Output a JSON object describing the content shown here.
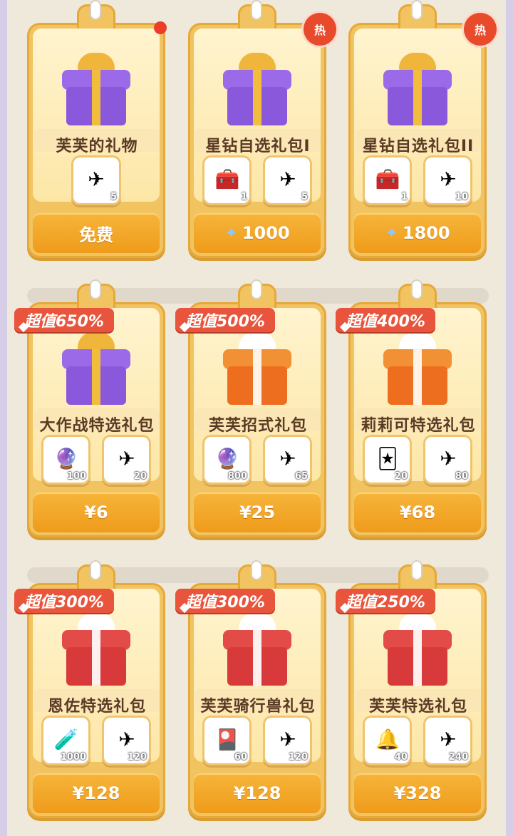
{
  "colors": {
    "accent": "#ef9b1b",
    "hot": "#e84a2c",
    "banner": "#e9543c"
  },
  "cards": [
    {
      "title": "芙芙的礼物",
      "price": "免费",
      "price_icon": "",
      "badge": "",
      "show_dot": true,
      "gift": "purple",
      "items": [
        {
          "icon": "paper-plane-icon",
          "glyph": "✈",
          "count": "5"
        }
      ]
    },
    {
      "title": "星钻自选礼包I",
      "price": "1000",
      "price_icon": "star-icon",
      "badge": "热",
      "show_dot": false,
      "gift": "purple",
      "items": [
        {
          "icon": "treasure-chest-icon",
          "glyph": "🧰",
          "count": "1"
        },
        {
          "icon": "paper-plane-icon",
          "glyph": "✈",
          "count": "5"
        }
      ]
    },
    {
      "title": "星钻自选礼包II",
      "price": "1800",
      "price_icon": "star-icon",
      "badge": "热",
      "show_dot": false,
      "gift": "purple",
      "items": [
        {
          "icon": "treasure-chest-icon",
          "glyph": "🧰",
          "count": "1"
        },
        {
          "icon": "paper-plane-icon",
          "glyph": "✈",
          "count": "10"
        }
      ]
    },
    {
      "title": "大作战特选礼包",
      "price": "¥6",
      "deal": "超值650%",
      "gift": "purple",
      "items": [
        {
          "icon": "crystal-orb-icon",
          "glyph": "🔮",
          "count": "100"
        },
        {
          "icon": "paper-plane-icon",
          "glyph": "✈",
          "count": "20"
        }
      ]
    },
    {
      "title": "芙芙招式礼包",
      "price": "¥25",
      "deal": "超值500%",
      "gift": "orange",
      "items": [
        {
          "icon": "crystal-orb-icon",
          "glyph": "🔮",
          "count": "800"
        },
        {
          "icon": "paper-plane-icon",
          "glyph": "✈",
          "count": "65"
        }
      ]
    },
    {
      "title": "莉莉可特选礼包",
      "price": "¥68",
      "deal": "超值400%",
      "gift": "orange",
      "items": [
        {
          "icon": "card-icon",
          "glyph": "🃏",
          "count": "20"
        },
        {
          "icon": "paper-plane-icon",
          "glyph": "✈",
          "count": "80"
        }
      ]
    },
    {
      "title": "恩佐特选礼包",
      "price": "¥128",
      "deal": "超值300%",
      "gift": "red",
      "items": [
        {
          "icon": "energy-capsule-icon",
          "glyph": "🧪",
          "count": "1000"
        },
        {
          "icon": "paper-plane-icon",
          "glyph": "✈",
          "count": "120"
        }
      ]
    },
    {
      "title": "芙芙骑行兽礼包",
      "price": "¥128",
      "deal": "超值300%",
      "gift": "red",
      "items": [
        {
          "icon": "mount-card-icon",
          "glyph": "🎴",
          "count": "60"
        },
        {
          "icon": "paper-plane-icon",
          "glyph": "✈",
          "count": "120"
        }
      ]
    },
    {
      "title": "芙芙特选礼包",
      "price": "¥328",
      "deal": "超值250%",
      "gift": "red",
      "items": [
        {
          "icon": "music-bell-icon",
          "glyph": "🔔",
          "count": "40"
        },
        {
          "icon": "paper-plane-icon",
          "glyph": "✈",
          "count": "240"
        }
      ]
    }
  ]
}
